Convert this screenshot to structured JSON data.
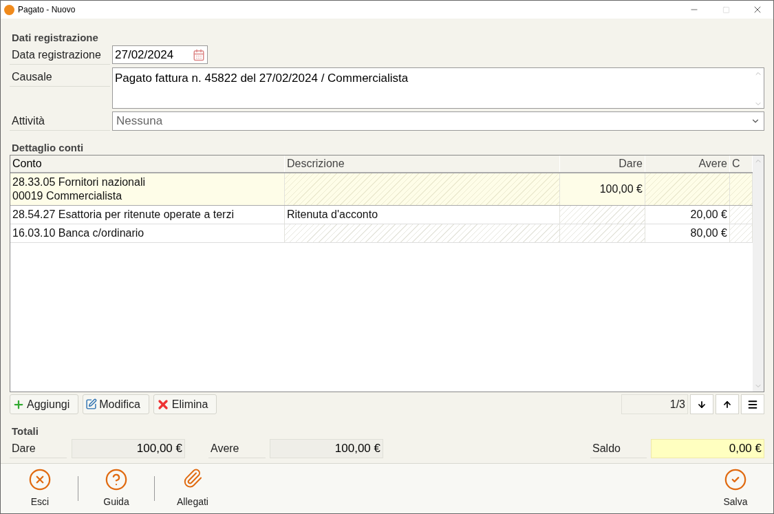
{
  "window": {
    "title": "Pagato - Nuovo"
  },
  "registration": {
    "title": "Dati registrazione",
    "fields": [
      {
        "kind": "date",
        "label": "Data registrazione",
        "value": "27/02/2024"
      },
      {
        "kind": "memo",
        "label": "Causale",
        "value": "Pagato fattura n. 45822 del 27/02/2024 / Commercialista"
      },
      {
        "kind": "select",
        "label": "Attività",
        "placeholder": "Nessuna"
      }
    ]
  },
  "details": {
    "title": "Dettaglio conti",
    "columns": [
      "Conto",
      "Descrizione",
      "Dare",
      "Avere",
      "C"
    ],
    "rows": [
      {
        "selected": true,
        "conto": [
          "28.33.05 Fornitori nazionali",
          "00019 Commercialista"
        ],
        "descrizione": "",
        "dare": "100,00 €",
        "avere": ""
      },
      {
        "selected": false,
        "conto": [
          "28.54.27 Esattoria per ritenute operate a terzi"
        ],
        "descrizione": "Ritenuta d'acconto",
        "dare": "",
        "avere": "20,00 €"
      },
      {
        "selected": false,
        "conto": [
          "16.03.10 Banca c/ordinario"
        ],
        "descrizione": "",
        "dare": "",
        "avere": "80,00 €"
      }
    ],
    "buttons": [
      {
        "kind": "add",
        "label": "Aggiungi"
      },
      {
        "kind": "edit",
        "label": "Modifica"
      },
      {
        "kind": "delete",
        "label": "Elimina"
      }
    ],
    "counter": "1/3"
  },
  "totals": {
    "title": "Totali",
    "dare_label": "Dare",
    "dare": "100,00 €",
    "avere_label": "Avere",
    "avere": "100,00 €",
    "saldo_label": "Saldo",
    "saldo": "0,00 €"
  },
  "footer": [
    {
      "kind": "exit",
      "label": "Esci"
    },
    {
      "kind": "help",
      "label": "Guida"
    },
    {
      "kind": "attach",
      "label": "Allegati"
    },
    {
      "kind": "save",
      "label": "Salva"
    }
  ]
}
